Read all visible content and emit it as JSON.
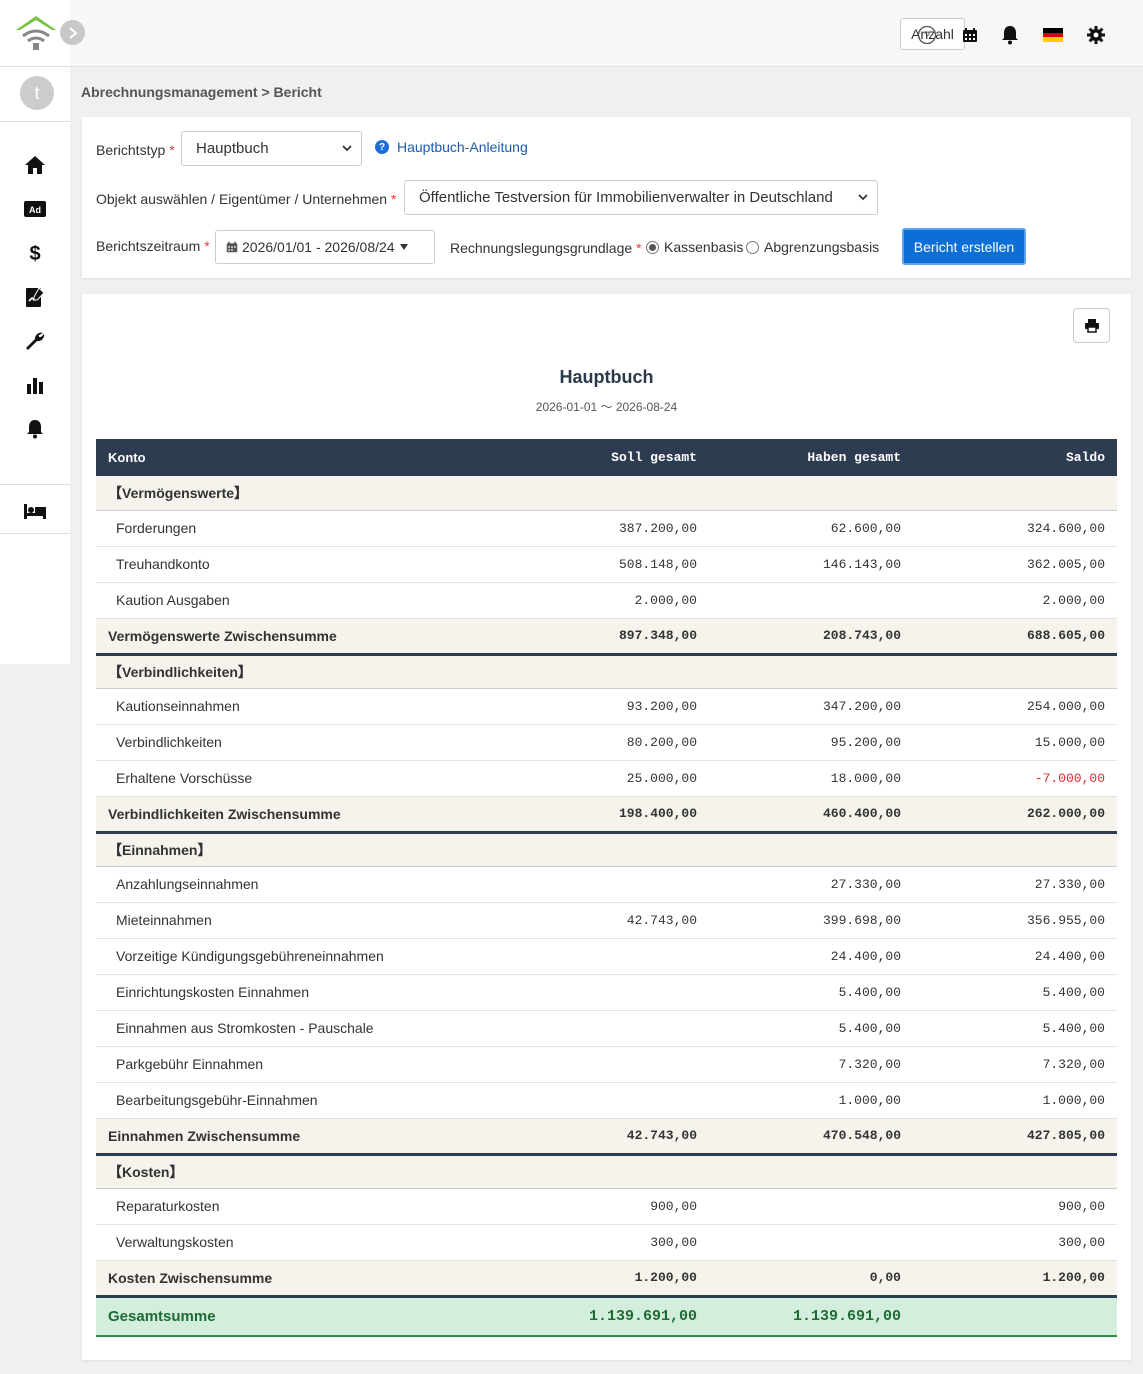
{
  "header": {
    "count_button": "Anzahl"
  },
  "breadcrumb": "Abrechnungsmanagement > Bericht",
  "sidebar": {
    "avatar_letter": "t"
  },
  "filters": {
    "report_type_label": "Berichtstyp",
    "report_type_value": "Hauptbuch",
    "help_link": "Hauptbuch-Anleitung",
    "object_label": "Objekt auswählen / Eigentümer / Unternehmen",
    "object_value": "Öffentliche Testversion für Immobilienverwalter in Deutschland",
    "period_label": "Berichtszeitraum",
    "period_value": "2026/01/01 - 2026/08/24",
    "basis_label": "Rechnungslegungsgrundlage",
    "basis_cash": "Kassenbasis",
    "basis_accrual": "Abgrenzungsbasis",
    "basis_selected": "Kassenbasis",
    "create_button": "Bericht erstellen"
  },
  "report": {
    "title": "Hauptbuch",
    "period": "2026-01-01 〜 2026-08-24",
    "columns": [
      "Konto",
      "Soll gesamt",
      "Haben gesamt",
      "Saldo"
    ],
    "rows": [
      {
        "type": "section",
        "name": "【Vermögenswerte】",
        "soll": "",
        "haben": "",
        "saldo": ""
      },
      {
        "type": "item",
        "name": "Forderungen",
        "soll": "387.200,00",
        "haben": "62.600,00",
        "saldo": "324.600,00"
      },
      {
        "type": "item",
        "name": "Treuhandkonto",
        "soll": "508.148,00",
        "haben": "146.143,00",
        "saldo": "362.005,00"
      },
      {
        "type": "item",
        "name": "Kaution Ausgaben",
        "soll": "2.000,00",
        "haben": "",
        "saldo": "2.000,00"
      },
      {
        "type": "subtotal",
        "name": "Vermögenswerte Zwischensumme",
        "soll": "897.348,00",
        "haben": "208.743,00",
        "saldo": "688.605,00"
      },
      {
        "type": "section",
        "name": "【Verbindlichkeiten】",
        "soll": "",
        "haben": "",
        "saldo": ""
      },
      {
        "type": "item",
        "name": "Kautionseinnahmen",
        "soll": "93.200,00",
        "haben": "347.200,00",
        "saldo": "254.000,00"
      },
      {
        "type": "item",
        "name": "Verbindlichkeiten",
        "soll": "80.200,00",
        "haben": "95.200,00",
        "saldo": "15.000,00"
      },
      {
        "type": "item",
        "name": "Erhaltene Vorschüsse",
        "soll": "25.000,00",
        "haben": "18.000,00",
        "saldo": "-7.000,00"
      },
      {
        "type": "subtotal",
        "name": "Verbindlichkeiten Zwischensumme",
        "soll": "198.400,00",
        "haben": "460.400,00",
        "saldo": "262.000,00"
      },
      {
        "type": "section",
        "name": "【Einnahmen】",
        "soll": "",
        "haben": "",
        "saldo": ""
      },
      {
        "type": "item",
        "name": "Anzahlungseinnahmen",
        "soll": "",
        "haben": "27.330,00",
        "saldo": "27.330,00"
      },
      {
        "type": "item",
        "name": "Mieteinnahmen",
        "soll": "42.743,00",
        "haben": "399.698,00",
        "saldo": "356.955,00"
      },
      {
        "type": "item",
        "name": "Vorzeitige Kündigungsgebühreneinnahmen",
        "soll": "",
        "haben": "24.400,00",
        "saldo": "24.400,00"
      },
      {
        "type": "item",
        "name": "Einrichtungskosten Einnahmen",
        "soll": "",
        "haben": "5.400,00",
        "saldo": "5.400,00"
      },
      {
        "type": "item",
        "name": "Einnahmen aus Stromkosten - Pauschale",
        "soll": "",
        "haben": "5.400,00",
        "saldo": "5.400,00"
      },
      {
        "type": "item",
        "name": "Parkgebühr Einnahmen",
        "soll": "",
        "haben": "7.320,00",
        "saldo": "7.320,00"
      },
      {
        "type": "item",
        "name": "Bearbeitungsgebühr-Einnahmen",
        "soll": "",
        "haben": "1.000,00",
        "saldo": "1.000,00"
      },
      {
        "type": "subtotal",
        "name": "Einnahmen Zwischensumme",
        "soll": "42.743,00",
        "haben": "470.548,00",
        "saldo": "427.805,00"
      },
      {
        "type": "section",
        "name": "【Kosten】",
        "soll": "",
        "haben": "",
        "saldo": ""
      },
      {
        "type": "item",
        "name": "Reparaturkosten",
        "soll": "900,00",
        "haben": "",
        "saldo": "900,00"
      },
      {
        "type": "item",
        "name": "Verwaltungskosten",
        "soll": "300,00",
        "haben": "",
        "saldo": "300,00"
      },
      {
        "type": "subtotal",
        "name": "Kosten Zwischensumme",
        "soll": "1.200,00",
        "haben": "0,00",
        "saldo": "1.200,00"
      },
      {
        "type": "total",
        "name": "Gesamtsumme",
        "soll": "1.139.691,00",
        "haben": "1.139.691,00",
        "saldo": ""
      }
    ]
  },
  "colors": {
    "header_bg": "#2d3c50",
    "accent": "#0d6fd6",
    "total_bg": "#d3eedc",
    "negative": "#d32f2f",
    "logo_green": "#7ac143"
  }
}
